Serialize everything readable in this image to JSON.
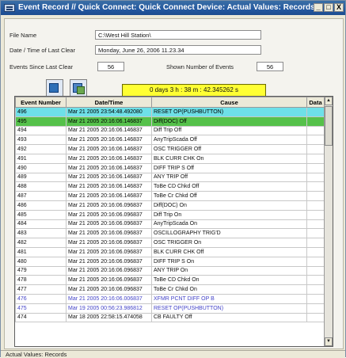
{
  "window": {
    "title": "Event Record // Quick Connect: Quick Connect Device: Actual Values: Records",
    "min_label": "_",
    "max_label": "□",
    "close_label": "X"
  },
  "header": {
    "file_name_label": "File Name",
    "file_name_value": "C:\\West Hill Station\\",
    "last_clear_label": "Date / Time of Last Clear",
    "last_clear_value": "Monday, June 26, 2006 11.23.34",
    "events_since_label": "Events Since Last Clear",
    "events_since_value": "56",
    "shown_label": "Shown Number of Events",
    "shown_value": "56"
  },
  "toolbar": {
    "timer_text": "0 days   3 h :  38 m :  42.345262 s"
  },
  "table": {
    "columns": [
      "Event Number",
      "Date/Time",
      "Cause",
      "Data"
    ],
    "rows": [
      {
        "num": "496",
        "dt": "Mar 21 2005 23:54:48.492080",
        "cause": "RESET OP(PUSHBUTTON)",
        "style": "cyan"
      },
      {
        "num": "495",
        "dt": "Mar 21 2005 20:16:06.146837",
        "cause": "Diff(DOC)   Off",
        "style": "green"
      },
      {
        "num": "494",
        "dt": "Mar 21 2005 20:16:06.146837",
        "cause": "Diff Trip    Off",
        "style": ""
      },
      {
        "num": "493",
        "dt": "Mar 21 2005 20:16:06.146837",
        "cause": "AnyTripScada Off",
        "style": ""
      },
      {
        "num": "492",
        "dt": "Mar 21 2005 20:16:06.146837",
        "cause": "OSC TRIGGER Off",
        "style": ""
      },
      {
        "num": "491",
        "dt": "Mar 21 2005 20:16:06.146837",
        "cause": "BLK CURR CHK On",
        "style": ""
      },
      {
        "num": "490",
        "dt": "Mar 21 2005 20:16:06.146837",
        "cause": "DIFF TRIP S  Off",
        "style": ""
      },
      {
        "num": "489",
        "dt": "Mar 21 2005 20:16:06.146837",
        "cause": "ANY TRIP    Off",
        "style": ""
      },
      {
        "num": "488",
        "dt": "Mar 21 2005 20:16:06.146837",
        "cause": "ToBe CD Chkd Off",
        "style": ""
      },
      {
        "num": "487",
        "dt": "Mar 21 2005 20:16:06.146837",
        "cause": "ToBe Cr Chkd Off",
        "style": ""
      },
      {
        "num": "486",
        "dt": "Mar 21 2005 20:16:06.096837",
        "cause": "Diff(DOC)   On",
        "style": ""
      },
      {
        "num": "485",
        "dt": "Mar 21 2005 20:16:06.096837",
        "cause": "Diff Trip    On",
        "style": ""
      },
      {
        "num": "484",
        "dt": "Mar 21 2005 20:16:06.096837",
        "cause": "AnyTripScada On",
        "style": ""
      },
      {
        "num": "483",
        "dt": "Mar 21 2005 20:16:06.096837",
        "cause": "OSCILLOGRAPHY TRIG'D",
        "style": ""
      },
      {
        "num": "482",
        "dt": "Mar 21 2005 20:16:06.096837",
        "cause": "OSC TRIGGER On",
        "style": ""
      },
      {
        "num": "481",
        "dt": "Mar 21 2005 20:16:06.096837",
        "cause": "BLK CURR CHK Off",
        "style": ""
      },
      {
        "num": "480",
        "dt": "Mar 21 2005 20:16:06.096837",
        "cause": "DIFF TRIP S  On",
        "style": ""
      },
      {
        "num": "479",
        "dt": "Mar 21 2005 20:16:06.096837",
        "cause": "ANY TRIP    On",
        "style": ""
      },
      {
        "num": "478",
        "dt": "Mar 21 2005 20:16:06.096837",
        "cause": "ToBe CD Chkd On",
        "style": ""
      },
      {
        "num": "477",
        "dt": "Mar 21 2005 20:16:06.096837",
        "cause": "ToBe Cr Chkd On",
        "style": ""
      },
      {
        "num": "476",
        "dt": "Mar 21 2005 20:16:06.006837",
        "cause": "XFMR PCNT DIFF OP B",
        "style": "blue"
      },
      {
        "num": "475",
        "dt": "Mar 19 2005 00:56:23.986812",
        "cause": "RESET OP(PUSHBUTTON)",
        "style": "blue"
      },
      {
        "num": "474",
        "dt": "Mar 18 2005 22:58:15.474058",
        "cause": "CB FAULTY   Off",
        "style": ""
      }
    ],
    "scroll_up": "▲",
    "scroll_down": "▼"
  },
  "status": {
    "text": "Actual Values: Records"
  }
}
